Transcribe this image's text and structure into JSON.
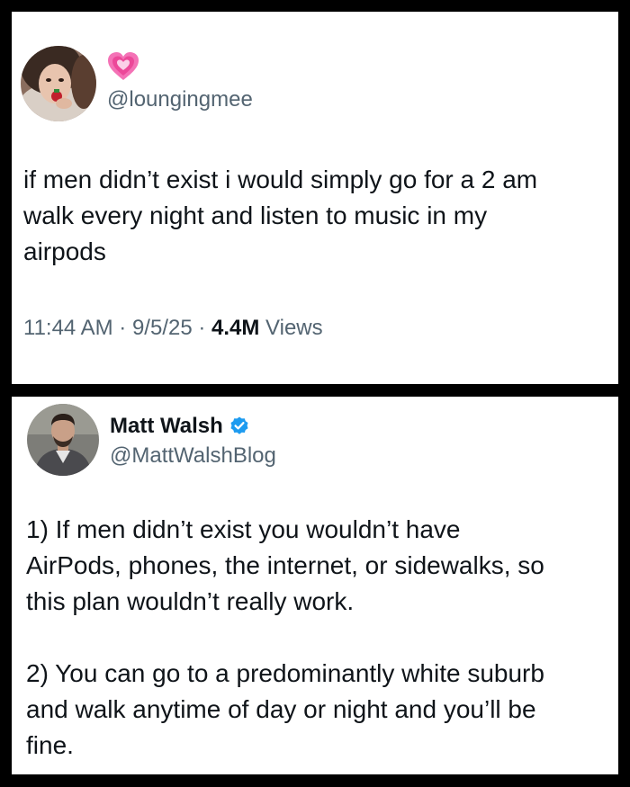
{
  "tweet1": {
    "emoji": "💗",
    "handle": "@loungingmee",
    "text_lines": [
      "if men didn’t exist i would simply go for a 2 am",
      "walk every night and listen to music in my",
      "airpods"
    ],
    "time": "11:44 AM",
    "separator": " · ",
    "date": "9/5/25",
    "views_count": "4.4M",
    "views_label": " Views"
  },
  "tweet2": {
    "display_name": "Matt Walsh",
    "verified": true,
    "handle": "@MattWalshBlog",
    "paragraph1_lines": [
      "1) If men didn’t exist you wouldn’t have",
      "AirPods, phones, the internet, or sidewalks, so",
      "this plan wouldn’t really work."
    ],
    "paragraph2_lines": [
      "2) You can go to a predominantly white suburb",
      "and walk anytime of day or night and you’ll be",
      "fine."
    ]
  },
  "colors": {
    "background": "#000000",
    "card": "#ffffff",
    "text": "#0f1419",
    "secondary": "#536471",
    "verified": "#1d9bf0",
    "heart": "#f0509a"
  },
  "icons": {
    "heart": "growing-heart-icon",
    "verified": "verified-badge-icon"
  }
}
